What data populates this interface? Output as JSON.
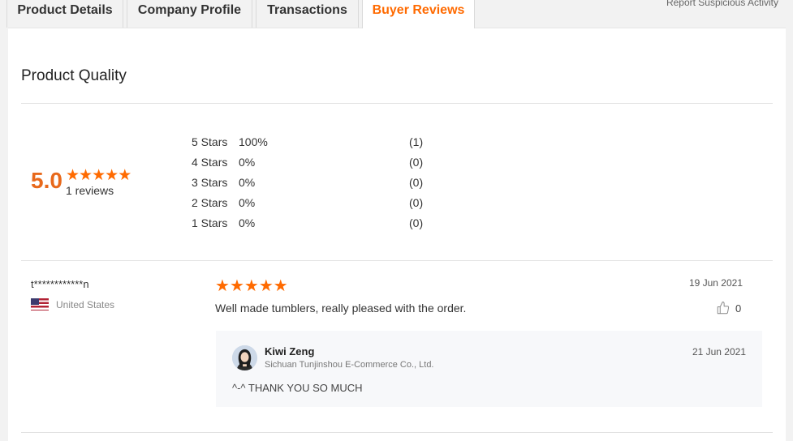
{
  "tabs": [
    {
      "label": "Product Details"
    },
    {
      "label": "Company Profile"
    },
    {
      "label": "Transactions"
    },
    {
      "label": "Buyer Reviews"
    }
  ],
  "active_tab": "Buyer Reviews",
  "report_link": "Report Suspicious Activity",
  "section_title": "Product Quality",
  "summary": {
    "score": "5.0",
    "stars": 5,
    "count_text": "1 reviews"
  },
  "distribution": [
    {
      "label": "5 Stars",
      "percent": "100%",
      "count": "(1)"
    },
    {
      "label": "4 Stars",
      "percent": "0%",
      "count": "(0)"
    },
    {
      "label": "3 Stars",
      "percent": "0%",
      "count": "(0)"
    },
    {
      "label": "2 Stars",
      "percent": "0%",
      "count": "(0)"
    },
    {
      "label": "1 Stars",
      "percent": "0%",
      "count": "(0)"
    }
  ],
  "review": {
    "reviewer": "t************n",
    "country": "United States",
    "stars": 5,
    "text": "Well made tumblers, really pleased with the order.",
    "date": "19 Jun 2021",
    "helpful_count": "0",
    "reply": {
      "name": "Kiwi Zeng",
      "company": "Sichuan Tunjinshou E-Commerce Co., Ltd.",
      "date": "21 Jun 2021",
      "text": "^-^ THANK YOU SO MUCH"
    }
  },
  "colors": {
    "accent": "#ff6a00",
    "score": "#e8691c",
    "reply_bg": "#f7f8fa"
  },
  "icons": [
    "star-icon",
    "flag-us-icon",
    "thumbs-up-icon",
    "avatar"
  ]
}
